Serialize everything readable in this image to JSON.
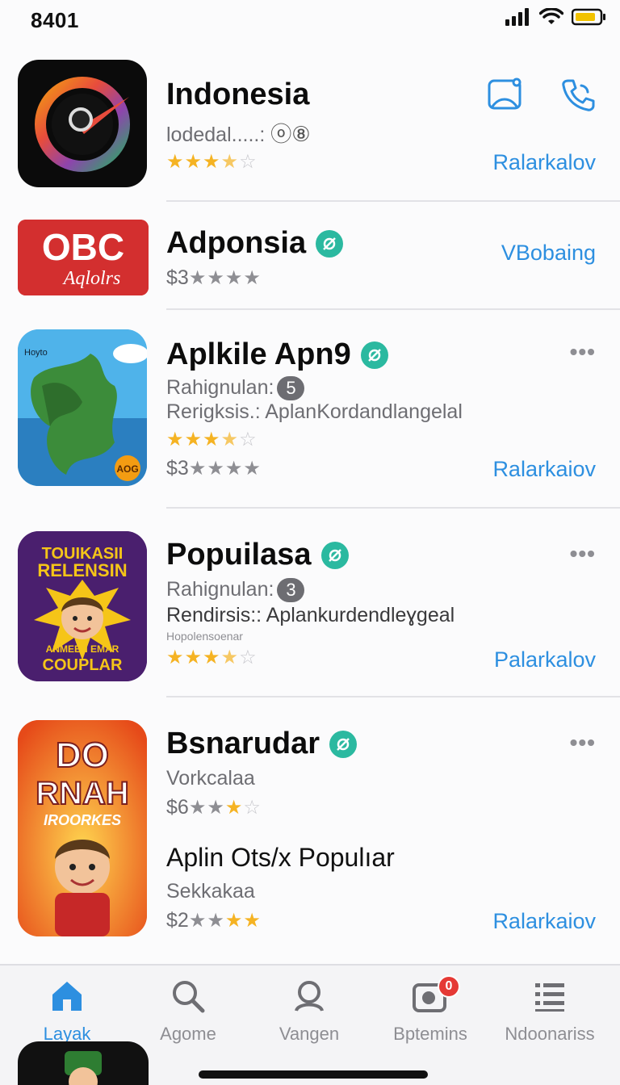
{
  "status_bar": {
    "time": "8401"
  },
  "apps": [
    {
      "title": "Indonesia",
      "line1": "lodedal.....: ",
      "line1_suffix": "ⓞ⑧",
      "stars": "3.5",
      "action": "Ralarkalov"
    },
    {
      "title": "Adponsia",
      "price": "$3",
      "action": "VBobaing",
      "icon_text1": "OBC",
      "icon_text2": "Aqlolrs"
    },
    {
      "title": "Aplkile Apn9",
      "line1": "Rahignulan:",
      "line1_pill": "5",
      "line2": "Rerigksis.: AplanKordandlangelal",
      "price": "$3",
      "action": "Ralarkaiov",
      "more": "•••",
      "icon_text1": "Hoyto",
      "icon_text2": "AOG"
    },
    {
      "title": "Popuilasa",
      "line1": "Rahignulan:",
      "line1_pill": "3",
      "line2": "Rendirsis:: Aplankurdendleɣgeal",
      "line3": "Hopolensoenar",
      "action": "Palarkalov",
      "more": "•••",
      "icon_text1": "TOUIKASII",
      "icon_text2": "RELENSIN",
      "icon_text3": "ANMEEN EMAR",
      "icon_text4": "COUPLAR"
    },
    {
      "title": "Bsnarudar",
      "line1": "Vorkcalaa",
      "price": "$6",
      "line2": "Aplin Ots/x Populıar",
      "line3": "Sekkakaa",
      "price2": "$2",
      "action": "Ralarkaiov",
      "more": "•••",
      "icon_text1": "DO",
      "icon_text2": "RNAH",
      "icon_text3": "IROORKES"
    }
  ],
  "tabs": [
    {
      "label": "Layak",
      "icon": "house-icon",
      "active": true
    },
    {
      "label": "Agome",
      "icon": "search-icon"
    },
    {
      "label": "Vangen",
      "icon": "person-icon"
    },
    {
      "label": "Bptemins",
      "icon": "updates-icon",
      "badge": "0"
    },
    {
      "label": "Ndoonariss",
      "icon": "list-icon"
    }
  ],
  "colors": {
    "accent": "#2d8fe0",
    "verified": "#2bb9a0",
    "star": "#f5b323",
    "badge": "#e53935"
  }
}
